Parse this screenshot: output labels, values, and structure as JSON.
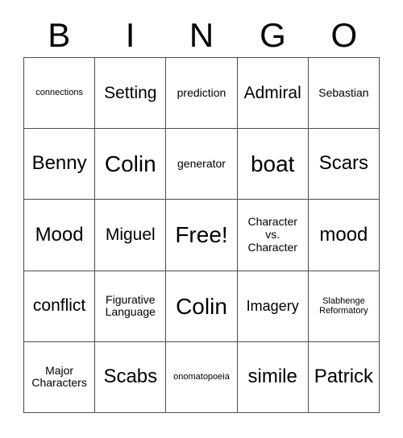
{
  "card": {
    "header_letters": [
      "B",
      "I",
      "N",
      "G",
      "O"
    ],
    "rows": [
      [
        {
          "text": "connections",
          "size": "fs-xs"
        },
        {
          "text": "Setting",
          "size": "fs-lg"
        },
        {
          "text": "prediction",
          "size": "fs-sm"
        },
        {
          "text": "Admiral",
          "size": "fs-lg"
        },
        {
          "text": "Sebastian",
          "size": "fs-sm"
        }
      ],
      [
        {
          "text": "Benny",
          "size": "fs-xl"
        },
        {
          "text": "Colin",
          "size": "fs-xxl"
        },
        {
          "text": "generator",
          "size": "fs-sm"
        },
        {
          "text": "boat",
          "size": "fs-xxl"
        },
        {
          "text": "Scars",
          "size": "fs-xl"
        }
      ],
      [
        {
          "text": "Mood",
          "size": "fs-xl"
        },
        {
          "text": "Miguel",
          "size": "fs-lg"
        },
        {
          "text": "Free!",
          "size": "fs-xxl"
        },
        {
          "text": "Character vs. Character",
          "size": "fs-sm"
        },
        {
          "text": "mood",
          "size": "fs-xl"
        }
      ],
      [
        {
          "text": "conflict",
          "size": "fs-lg"
        },
        {
          "text": "Figurative Language",
          "size": "fs-sm"
        },
        {
          "text": "Colin",
          "size": "fs-xxl"
        },
        {
          "text": "Imagery",
          "size": "fs-md"
        },
        {
          "text": "Slabhenge Reformatory",
          "size": "fs-xs"
        }
      ],
      [
        {
          "text": "Major Characters",
          "size": "fs-sm"
        },
        {
          "text": "Scabs",
          "size": "fs-xl"
        },
        {
          "text": "onomatopoeia",
          "size": "fs-xs"
        },
        {
          "text": "simile",
          "size": "fs-xl"
        },
        {
          "text": "Patrick",
          "size": "fs-xl"
        }
      ]
    ]
  }
}
